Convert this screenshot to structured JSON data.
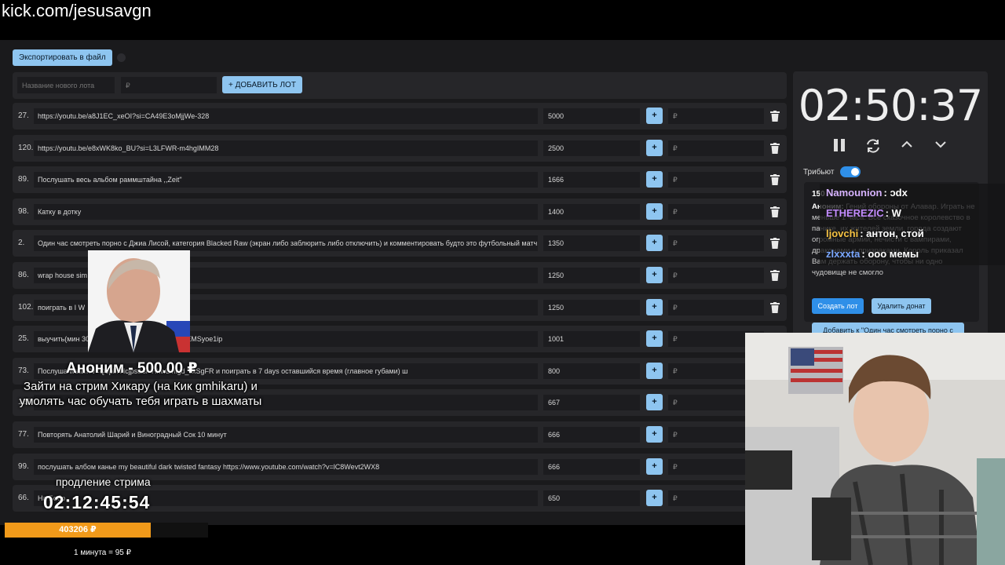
{
  "url": "kick.com/jesusavgn",
  "toolbar": {
    "export_label": "Экспортировать в файл"
  },
  "add_lot": {
    "name_placeholder": "Название нового лота",
    "price_placeholder": "₽",
    "add_label": "+ ДОБАВИТЬ ЛОТ"
  },
  "lots": [
    {
      "num": "27.",
      "title": "https://youtu.be/a8J1EC_xeOI?si=CA49E3oMjjWe-328",
      "amount": "5000"
    },
    {
      "num": "120.",
      "title": "https://youtu.be/e8xWK8ko_BU?si=L3LFWR-m4hgIMM28",
      "amount": "2500"
    },
    {
      "num": "89.",
      "title": "Послушать весь альбом раммштайна ,,Zeit\"",
      "amount": "1666"
    },
    {
      "num": "98.",
      "title": "Катку в дотку",
      "amount": "1400"
    },
    {
      "num": "2.",
      "title": "Один час смотреть порно с Джиа Лисой, категория Blacked Raw (экран либо заблюрить либо отключить) и комментировать будто это футбольный матч, ф",
      "amount": "1350"
    },
    {
      "num": "86.",
      "title": "wrap house sim                                  к человек для игры",
      "amount": "1250"
    },
    {
      "num": "102.",
      "title": "поиграть в I W",
      "amount": "1250"
    },
    {
      "num": "25.",
      "title": "выучить(мин 30                                   be/wnd558NcdUA?si=Sr3tJkVEMSyoe1ip",
      "amount": "1001"
    },
    {
      "num": "73.",
      "title": "Послуша                         watch?v=Q9pli7Hcjps&si=HhwLmigd_tlxSgFR и поиграть в 7 days оставшийся время (главное губами) ш",
      "amount": "800"
    },
    {
      "num": "128.",
      "title": "",
      "amount": "667"
    },
    {
      "num": "77.",
      "title": "Повторять Анатолий Шарий и Виноградный Сок 10 минут",
      "amount": "666"
    },
    {
      "num": "99.",
      "title": "послушать албом канье my beautiful dark twisted fantasy https://www.youtube.com/watch?v=lC8Wevt2WX8",
      "amount": "666"
    },
    {
      "num": "66.",
      "title": "На        Бобр",
      "amount": "650"
    }
  ],
  "lot_plus": "+",
  "lot_price_placeholder": "₽",
  "timer": {
    "time": "02:50:37",
    "tribute_label": "Трибьют"
  },
  "donate": {
    "head": "150",
    "author": "Аноним:",
    "text": "Гений обороны от Алавар. Играть не меньше 1 часа. Все сказочное королевство в панике, их жителей земли, города создают огромные армии, нечисти с вампирами, драконами и призраками. Король приказал Вам держать оборону, чтобы ни одно чудовище не смогло",
    "create_label": "Создать лот",
    "delete_label": "Удалить донат",
    "add_to_label": "Добавить к \"Один час смотреть порно с"
  },
  "chat": [
    {
      "user": "Namounion",
      "msg": ": ͻdx",
      "color": "#d7b3ff"
    },
    {
      "user": "ETHEREZIC",
      "msg": ": W",
      "color": "#c38cff"
    },
    {
      "user": "ljovchi",
      "msg": ": антон, стой",
      "color": "#f5c242"
    },
    {
      "user": "zlxxxta",
      "msg": ": ооо мемы",
      "color": "#7aa7ff"
    }
  ],
  "overlay": {
    "name": "Аноним - 500.00 ₽",
    "message": "Зайти на стрим Хикару (на Кик gmhikaru) и умолять час обучать тебя играть в шахматы",
    "extension_label": "продление стрима",
    "extension_time": "02:12:45:54"
  },
  "progress": {
    "label": "403206 ₽",
    "fill_percent": 72
  },
  "rate": "1 минута = 95 ₽"
}
